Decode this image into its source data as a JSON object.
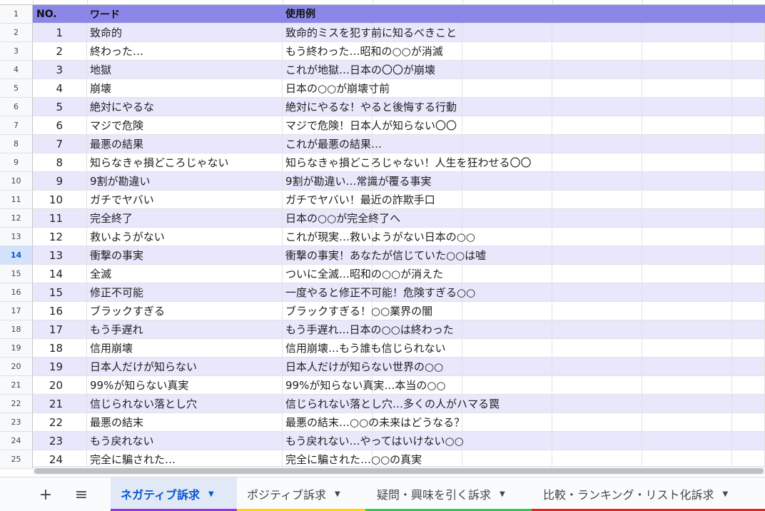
{
  "header": {
    "no": "NO.",
    "word": "ワード",
    "example": "使用例"
  },
  "row_numbers": [
    "1",
    "2",
    "3",
    "4",
    "5",
    "6",
    "7",
    "8",
    "9",
    "10",
    "11",
    "12",
    "13",
    "14",
    "15",
    "16",
    "17",
    "18",
    "19",
    "20",
    "21",
    "22",
    "23",
    "24",
    "25"
  ],
  "selected_row": "14",
  "rows": [
    {
      "no": "1",
      "word": "致命的",
      "example": "致命的ミスを犯す前に知るべきこと"
    },
    {
      "no": "2",
      "word": "終わった…",
      "example": "もう終わった…昭和の○○が消滅"
    },
    {
      "no": "3",
      "word": "地獄",
      "example": "これが地獄…日本の〇〇が崩壊"
    },
    {
      "no": "4",
      "word": "崩壊",
      "example": "日本の○○が崩壊寸前"
    },
    {
      "no": "5",
      "word": "絶対にやるな",
      "example": "絶対にやるな！やると後悔する行動"
    },
    {
      "no": "6",
      "word": "マジで危険",
      "example": "マジで危険！日本人が知らない〇〇"
    },
    {
      "no": "7",
      "word": "最悪の結果",
      "example": "これが最悪の結果…"
    },
    {
      "no": "8",
      "word": "知らなきゃ損どころじゃない",
      "example": "知らなきゃ損どころじゃない！人生を狂わせる〇〇"
    },
    {
      "no": "9",
      "word": "9割が勘違い",
      "example": "9割が勘違い…常識が覆る事実"
    },
    {
      "no": "10",
      "word": "ガチでヤバい",
      "example": "ガチでヤバい！最近の詐欺手口"
    },
    {
      "no": "11",
      "word": "完全終了",
      "example": "日本の○○が完全終了へ"
    },
    {
      "no": "12",
      "word": "救いようがない",
      "example": "これが現実…救いようがない日本の○○"
    },
    {
      "no": "13",
      "word": "衝撃の事実",
      "example": "衝撃の事実！あなたが信じていた○○は嘘"
    },
    {
      "no": "14",
      "word": "全滅",
      "example": "ついに全滅…昭和の○○が消えた"
    },
    {
      "no": "15",
      "word": "修正不可能",
      "example": "一度やると修正不可能！危険すぎる○○"
    },
    {
      "no": "16",
      "word": "ブラックすぎる",
      "example": "ブラックすぎる！○○業界の闇"
    },
    {
      "no": "17",
      "word": "もう手遅れ",
      "example": "もう手遅れ…日本の○○は終わった"
    },
    {
      "no": "18",
      "word": "信用崩壊",
      "example": "信用崩壊…もう誰も信じられない"
    },
    {
      "no": "19",
      "word": "日本人だけが知らない",
      "example": "日本人だけが知らない世界の○○"
    },
    {
      "no": "20",
      "word": "99%が知らない真実",
      "example": "99%が知らない真実…本当の○○"
    },
    {
      "no": "21",
      "word": "信じられない落とし穴",
      "example": "信じられない落とし穴…多くの人がハマる罠"
    },
    {
      "no": "22",
      "word": "最悪の結末",
      "example": "最悪の結末…○○の未来はどうなる？"
    },
    {
      "no": "23",
      "word": "もう戻れない",
      "example": "もう戻れない…やってはいけない○○"
    },
    {
      "no": "24",
      "word": "完全に騙された…",
      "example": "完全に騙された…○○の真実"
    }
  ],
  "toolbar": {
    "add_sheet": "+",
    "all_sheets": "≡"
  },
  "tabs": [
    {
      "label": "ネガティブ訴求",
      "color": "#9334e6"
    },
    {
      "label": "ポジティブ訴求",
      "color": "#ffd600"
    },
    {
      "label": "疑問・興味を引く訴求",
      "color": "#34c759"
    },
    {
      "label": "比較・ランキング・リスト化訴求",
      "color": "#e8231f"
    }
  ],
  "icons": {
    "tab_caret": "▼"
  },
  "colors": {
    "header_bg": "#8b87e8",
    "band_bg": "#e8e7fc",
    "active_tab": "#0b57d0"
  }
}
